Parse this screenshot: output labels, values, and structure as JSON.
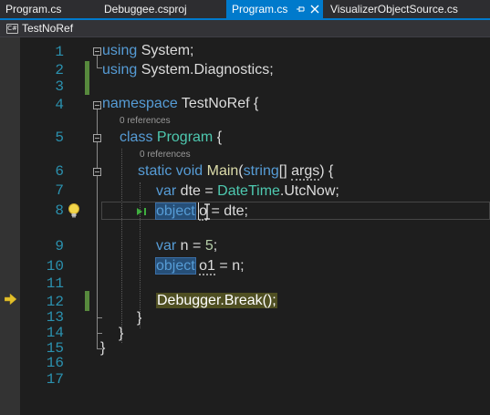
{
  "tabs": [
    {
      "label": "Program.cs",
      "active": false
    },
    {
      "label": "Debuggee.csproj",
      "active": false
    },
    {
      "label": "Program.cs",
      "active": true
    },
    {
      "label": "VisualizerObjectSource.cs",
      "active": false
    }
  ],
  "navbar": {
    "file_icon": "C#",
    "project": "TestNoRef"
  },
  "colors": {
    "accent": "#007acc",
    "keyword": "#569cd6",
    "type": "#4ec9b0",
    "method": "#dcdcaa",
    "number": "#b5cea8",
    "line_number": "#2b91af",
    "change_bar": "#57893d",
    "current_statement": "#4f4f22",
    "selection": "#264f78"
  },
  "icons": {
    "pin": "pin-icon",
    "tab_close": "close-icon",
    "lightbulb": "lightbulb-icon",
    "run_to_click": "run-to-click-icon",
    "execution_pointer": "arrow-icon",
    "cursor": "ibeam-icon"
  },
  "editor": {
    "line_numbers": [
      "1",
      "2",
      "3",
      "4",
      "5",
      "6",
      "7",
      "8",
      "9",
      "10",
      "11",
      "12",
      "13",
      "14",
      "15",
      "16",
      "17"
    ],
    "codelens": {
      "class_refs": "0 references",
      "method_refs": "0 references"
    },
    "lines": {
      "l1": {
        "kw": "using",
        "rest": " System;"
      },
      "l2": {
        "kw": "using",
        "rest": " System.Diagnostics;"
      },
      "l4": {
        "kw": "namespace",
        "rest": " TestNoRef {"
      },
      "l5": {
        "kw": "class",
        "name": "Program",
        "rest": " {"
      },
      "l6": {
        "kw1": "static",
        "kw2": "void",
        "name": "Main",
        "open": "(",
        "kw3": "string",
        "rest1": "[] ",
        "arg": "args",
        "rest2": ") {"
      },
      "l7": {
        "kw": "var",
        "rest1": " dte = ",
        "type": "DateTime",
        "rest2": ".UtcNow;"
      },
      "l8": {
        "kw": "object",
        "sp": " ",
        "var": "o",
        "rest": " = dte;"
      },
      "l10": {
        "kw": "var",
        "rest1": " n = ",
        "num": "5",
        "rest2": ";"
      },
      "l11": {
        "kw": "object",
        "sp": " ",
        "var": "o1",
        "rest": " = n;"
      },
      "l13": {
        "type": "Debugger",
        "rest1": ".",
        "fn": "Break",
        "rest2": "();"
      },
      "l14": {
        "text": "}"
      },
      "l15": {
        "text": "}"
      },
      "l16": {
        "text": "}"
      }
    }
  }
}
